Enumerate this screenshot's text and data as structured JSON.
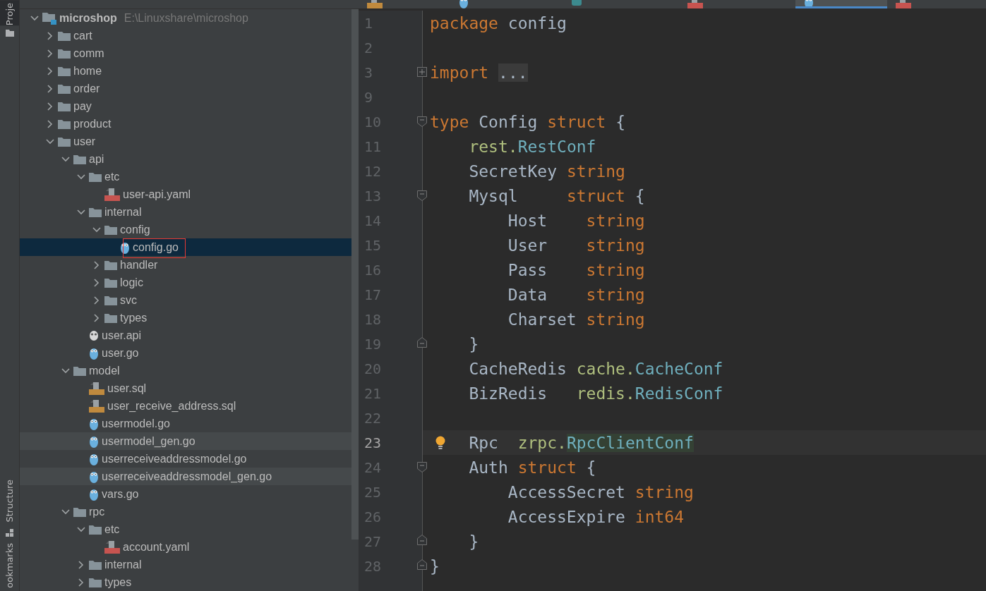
{
  "tool_strip": {
    "top": [
      {
        "label": "Proje",
        "selected": true
      }
    ],
    "bottom": [
      {
        "label": "Structure",
        "selected": false
      },
      {
        "label": "ookmarks",
        "selected": false
      }
    ]
  },
  "editor_tabs": [
    {
      "kind": "sql",
      "selected": false
    },
    {
      "kind": "go",
      "selected": false
    },
    {
      "kind": "proto",
      "selected": false
    },
    {
      "kind": "yaml",
      "selected": false
    },
    {
      "kind": "go",
      "selected": true
    },
    {
      "kind": "yaml",
      "selected": false
    }
  ],
  "project_tree": [
    {
      "kind": "module",
      "label": "microshop",
      "path": "E:\\Linuxshare\\microshop",
      "expanded": true,
      "children": [
        {
          "kind": "folder",
          "label": "cart",
          "expanded": false
        },
        {
          "kind": "folder",
          "label": "comm",
          "expanded": false
        },
        {
          "kind": "folder",
          "label": "home",
          "expanded": false
        },
        {
          "kind": "folder",
          "label": "order",
          "expanded": false
        },
        {
          "kind": "folder",
          "label": "pay",
          "expanded": false
        },
        {
          "kind": "folder",
          "label": "product",
          "expanded": false
        },
        {
          "kind": "folder",
          "label": "user",
          "expanded": true,
          "children": [
            {
              "kind": "folder",
              "label": "api",
              "expanded": true,
              "children": [
                {
                  "kind": "folder",
                  "label": "etc",
                  "expanded": true,
                  "children": [
                    {
                      "kind": "yaml",
                      "label": "user-api.yaml"
                    }
                  ]
                },
                {
                  "kind": "folder",
                  "label": "internal",
                  "expanded": true,
                  "children": [
                    {
                      "kind": "folder",
                      "label": "config",
                      "expanded": true,
                      "children": [
                        {
                          "kind": "go",
                          "label": "config.go",
                          "selected": true,
                          "boxed": true
                        }
                      ]
                    },
                    {
                      "kind": "folder",
                      "label": "handler",
                      "expanded": false
                    },
                    {
                      "kind": "folder",
                      "label": "logic",
                      "expanded": false
                    },
                    {
                      "kind": "folder",
                      "label": "svc",
                      "expanded": false
                    },
                    {
                      "kind": "folder",
                      "label": "types",
                      "expanded": false
                    }
                  ]
                },
                {
                  "kind": "api",
                  "label": "user.api"
                },
                {
                  "kind": "go",
                  "label": "user.go"
                }
              ]
            },
            {
              "kind": "folder",
              "label": "model",
              "expanded": true,
              "children": [
                {
                  "kind": "sql",
                  "label": "user.sql"
                },
                {
                  "kind": "sql",
                  "label": "user_receive_address.sql"
                },
                {
                  "kind": "go",
                  "label": "usermodel.go"
                },
                {
                  "kind": "go",
                  "label": "usermodel_gen.go",
                  "highlighted": true
                },
                {
                  "kind": "go",
                  "label": "userreceiveaddressmodel.go"
                },
                {
                  "kind": "go",
                  "label": "userreceiveaddressmodel_gen.go",
                  "highlighted": true
                },
                {
                  "kind": "go",
                  "label": "vars.go"
                }
              ]
            },
            {
              "kind": "folder",
              "label": "rpc",
              "expanded": true,
              "children": [
                {
                  "kind": "folder",
                  "label": "etc",
                  "expanded": true,
                  "children": [
                    {
                      "kind": "yaml",
                      "label": "account.yaml"
                    }
                  ]
                },
                {
                  "kind": "folder",
                  "label": "internal",
                  "expanded": false
                },
                {
                  "kind": "folder",
                  "label": "types",
                  "expanded": false
                }
              ]
            }
          ]
        }
      ]
    }
  ],
  "code_lines": [
    {
      "number": "1",
      "tokens": [
        {
          "kind": "keyword",
          "text": "package"
        },
        {
          "kind": "plain",
          "text": " config"
        }
      ]
    },
    {
      "number": "2"
    },
    {
      "number": "3",
      "collapsed": true,
      "tokens": [
        {
          "kind": "keyword",
          "text": "import"
        },
        {
          "kind": "folded",
          "text": "..."
        }
      ]
    },
    {
      "number": "9"
    },
    {
      "number": "10",
      "fold_start": true,
      "tokens": [
        {
          "kind": "keyword",
          "text": "type"
        },
        {
          "kind": "plain",
          "text": " Config "
        },
        {
          "kind": "keyword",
          "text": "struct"
        },
        {
          "kind": "plain",
          "text": " {"
        }
      ]
    },
    {
      "number": "11",
      "tokens": [
        {
          "kind": "package",
          "text": "    rest."
        },
        {
          "kind": "type",
          "text": "RestConf"
        }
      ]
    },
    {
      "number": "12",
      "tokens": [
        {
          "kind": "plain",
          "text": "    SecretKey "
        },
        {
          "kind": "keyword",
          "text": "string"
        }
      ]
    },
    {
      "number": "13",
      "fold_start": true,
      "tokens": [
        {
          "kind": "plain",
          "text": "    Mysql     "
        },
        {
          "kind": "keyword",
          "text": "struct"
        },
        {
          "kind": "plain",
          "text": " {"
        }
      ]
    },
    {
      "number": "14",
      "tokens": [
        {
          "kind": "plain",
          "text": "        Host    "
        },
        {
          "kind": "keyword",
          "text": "string"
        }
      ]
    },
    {
      "number": "15",
      "tokens": [
        {
          "kind": "plain",
          "text": "        User    "
        },
        {
          "kind": "keyword",
          "text": "string"
        }
      ]
    },
    {
      "number": "16",
      "tokens": [
        {
          "kind": "plain",
          "text": "        Pass    "
        },
        {
          "kind": "keyword",
          "text": "string"
        }
      ]
    },
    {
      "number": "17",
      "tokens": [
        {
          "kind": "plain",
          "text": "        Data    "
        },
        {
          "kind": "keyword",
          "text": "string"
        }
      ]
    },
    {
      "number": "18",
      "tokens": [
        {
          "kind": "plain",
          "text": "        Charset "
        },
        {
          "kind": "keyword",
          "text": "string"
        }
      ]
    },
    {
      "number": "19",
      "fold_end": true,
      "tokens": [
        {
          "kind": "plain",
          "text": "    }"
        }
      ]
    },
    {
      "number": "20",
      "tokens": [
        {
          "kind": "plain",
          "text": "    CacheRedis "
        },
        {
          "kind": "package",
          "text": "cache."
        },
        {
          "kind": "type",
          "text": "CacheConf"
        }
      ]
    },
    {
      "number": "21",
      "tokens": [
        {
          "kind": "plain",
          "text": "    BizRedis   "
        },
        {
          "kind": "package",
          "text": "redis."
        },
        {
          "kind": "type",
          "text": "RedisConf"
        }
      ]
    },
    {
      "number": "22"
    },
    {
      "number": "23",
      "current": true,
      "bulb": true,
      "tokens": [
        {
          "kind": "plain",
          "text": "    Rpc  "
        },
        {
          "kind": "package",
          "text": "zrpc."
        },
        {
          "kind": "type",
          "text": "RpcClientConf",
          "highlighted": true
        }
      ]
    },
    {
      "number": "24",
      "fold_start": true,
      "tokens": [
        {
          "kind": "plain",
          "text": "    Auth "
        },
        {
          "kind": "keyword",
          "text": "struct"
        },
        {
          "kind": "plain",
          "text": " {"
        }
      ]
    },
    {
      "number": "25",
      "tokens": [
        {
          "kind": "plain",
          "text": "        AccessSecret "
        },
        {
          "kind": "keyword",
          "text": "string"
        }
      ]
    },
    {
      "number": "26",
      "tokens": [
        {
          "kind": "plain",
          "text": "        AccessExpire "
        },
        {
          "kind": "keyword",
          "text": "int64"
        }
      ]
    },
    {
      "number": "27",
      "fold_end": true,
      "tokens": [
        {
          "kind": "plain",
          "text": "    }"
        }
      ]
    },
    {
      "number": "28",
      "fold_end": true,
      "tokens": [
        {
          "kind": "plain",
          "text": "}"
        }
      ]
    }
  ]
}
